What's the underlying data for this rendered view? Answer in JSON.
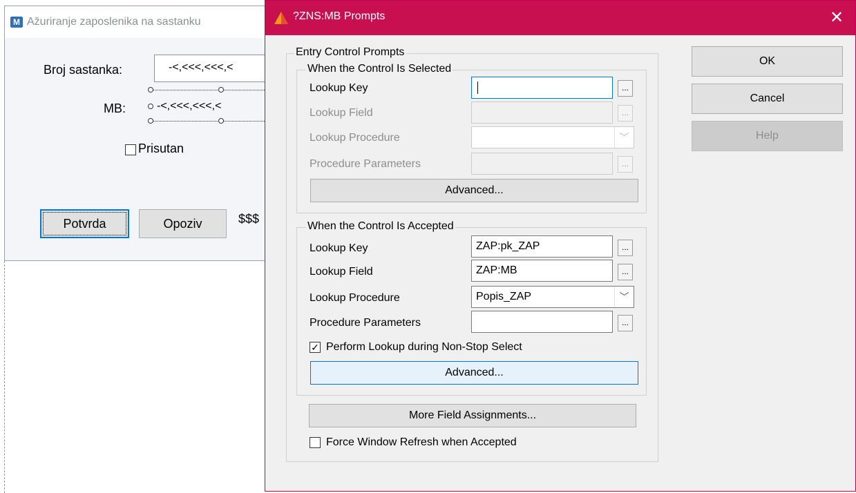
{
  "background_window": {
    "app_icon_letter": "M",
    "title": "Ažuriranje zaposlenika na sastanku",
    "broj_label": "Broj sastanka:",
    "broj_value": "-<,<<<,<<<,<",
    "mb_label": "MB:",
    "mb_value": "-<,<<<,<<<,<",
    "prisutan_label": "Prisutan",
    "potvrda_label": "Potvrda",
    "opoziv_label": "Opoziv",
    "currency_text": "$$$"
  },
  "dialog": {
    "title": "?ZNS:MB Prompts",
    "close_glyph": "✕",
    "ok_label": "OK",
    "cancel_label": "Cancel",
    "help_label": "Help",
    "entry_group_label": "Entry Control Prompts",
    "selected_group": {
      "label": "When the Control Is Selected",
      "lookup_key_label": "Lookup Key",
      "lookup_key_value": "",
      "lookup_field_label": "Lookup Field",
      "lookup_field_value": "",
      "lookup_procedure_label": "Lookup Procedure",
      "lookup_procedure_value": "",
      "procedure_parameters_label": "Procedure Parameters",
      "procedure_parameters_value": "",
      "advanced_label": "Advanced..."
    },
    "accepted_group": {
      "label": "When the Control Is Accepted",
      "lookup_key_label": "Lookup Key",
      "lookup_key_value": "ZAP:pk_ZAP",
      "lookup_field_label": "Lookup Field",
      "lookup_field_value": "ZAP:MB",
      "lookup_procedure_label": "Lookup Procedure",
      "lookup_procedure_value": "Popis_ZAP",
      "procedure_parameters_label": "Procedure Parameters",
      "procedure_parameters_value": "",
      "perform_lookup_label": "Perform Lookup during Non-Stop Select",
      "perform_lookup_checked": true,
      "advanced_label": "Advanced..."
    },
    "more_field_assignments_label": "More Field Assignments...",
    "force_refresh_label": "Force Window Refresh when Accepted",
    "force_refresh_checked": false,
    "ellipsis": "...",
    "checkmark": "✓",
    "combo_arrow": "﹀"
  },
  "colors": {
    "titlebar": "#c80f4f",
    "focus_blue": "#0078d7"
  }
}
